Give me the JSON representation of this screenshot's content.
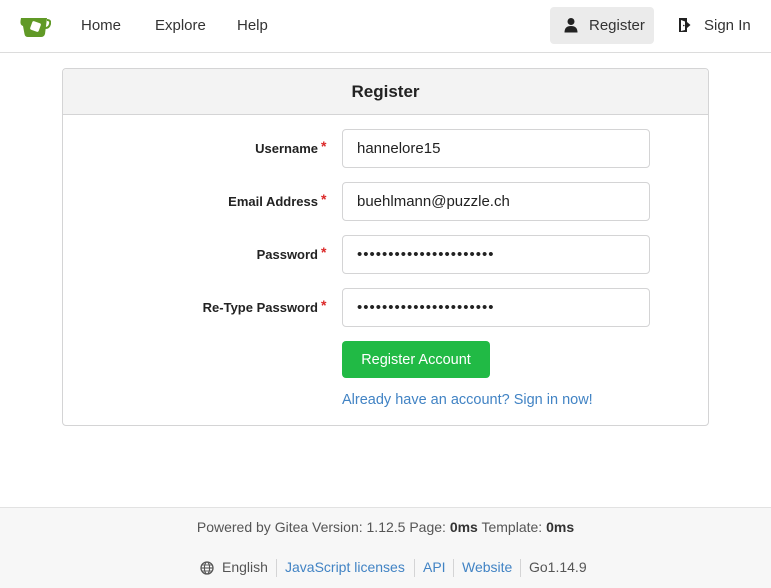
{
  "navbar": {
    "home": "Home",
    "explore": "Explore",
    "help": "Help",
    "register": "Register",
    "sign_in": "Sign In",
    "brand_color": "#609926"
  },
  "form": {
    "title": "Register",
    "required_mark": "*",
    "username": {
      "label": "Username",
      "value": "hannelore15"
    },
    "email": {
      "label": "Email Address",
      "value": "buehlmann@puzzle.ch"
    },
    "password": {
      "label": "Password",
      "value": "••••••••••••••••••••••"
    },
    "retype_password": {
      "label": "Re-Type Password",
      "value": "••••••••••••••••••••••"
    },
    "submit_label": "Register Account",
    "signin_link": "Already have an account? Sign in now!",
    "submit_color": "#21ba45",
    "link_color": "#4183c4"
  },
  "footer": {
    "powered_prefix": "Powered by Gitea Version: 1.12.5 Page:",
    "page_time": "0ms",
    "template_prefix": "Template:",
    "template_time": "0ms",
    "language": "English",
    "js_licenses": "JavaScript licenses",
    "api": "API",
    "website": "Website",
    "go_version": "Go1.14.9"
  },
  "icons": {
    "logo": "gitea-teacup-icon",
    "register": "user-icon",
    "sign_in": "sign-in-icon",
    "language": "globe-icon"
  }
}
